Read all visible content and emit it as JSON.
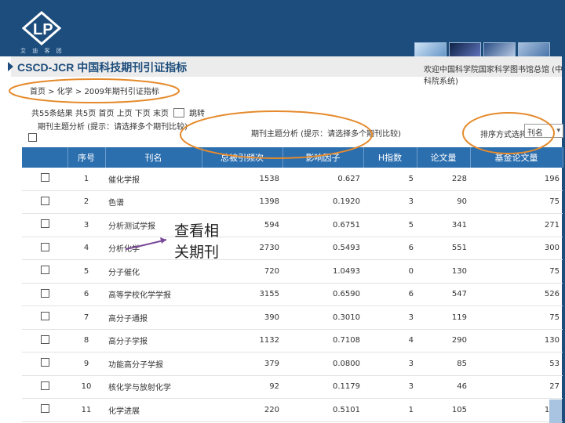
{
  "slide": {
    "logo_text": "艾 迪 客 团",
    "colors": {
      "banner": "#1d4d7c",
      "table_header": "#2c6faf",
      "annotation": "#e58a2c"
    }
  },
  "header": {
    "title": "CSCD-JCR 中国科技期刊引证指标",
    "right_text": "欢迎中国科学院国家科学图书馆总馆 (中科院系统)"
  },
  "breadcrumb": "首页 > 化学 > 2009年期刊引证指标",
  "paging": {
    "text": "共55条结果 共5页 首页 上页 下页 末页",
    "page_value": "",
    "jump_label": "跳转"
  },
  "category_line": "期刊主题分析 (提示：请选择多个期刊比较)",
  "filter_text": "期刊主题分析 (提示：请选择多个期刊比较)",
  "sort": {
    "label": "排序方式选择：",
    "selected": "刊名"
  },
  "table": {
    "headers": [
      "",
      "序号",
      "刊名",
      "总被引频次",
      "影响因子",
      "H指数",
      "论文量",
      "基金论文量"
    ],
    "rows": [
      {
        "n": "1",
        "title": "催化学报",
        "cites": "1538",
        "if": "0.627",
        "h": "5",
        "papers": "228",
        "fund": "196"
      },
      {
        "n": "2",
        "title": "色谱",
        "cites": "1398",
        "if": "0.1920",
        "h": "3",
        "papers": "90",
        "fund": "75"
      },
      {
        "n": "3",
        "title": "分析测试学报",
        "cites": "594",
        "if": "0.6751",
        "h": "5",
        "papers": "341",
        "fund": "271"
      },
      {
        "n": "4",
        "title": "分析化学",
        "cites": "2730",
        "if": "0.5493",
        "h": "6",
        "papers": "551",
        "fund": "300"
      },
      {
        "n": "5",
        "title": "分子催化",
        "cites": "720",
        "if": "1.0493",
        "h": "0",
        "papers": "130",
        "fund": "75"
      },
      {
        "n": "6",
        "title": "高等学校化学学报",
        "cites": "3155",
        "if": "0.6590",
        "h": "6",
        "papers": "547",
        "fund": "526"
      },
      {
        "n": "7",
        "title": "高分子通报",
        "cites": "390",
        "if": "0.3010",
        "h": "3",
        "papers": "119",
        "fund": "75"
      },
      {
        "n": "8",
        "title": "高分子学报",
        "cites": "1132",
        "if": "0.7108",
        "h": "4",
        "papers": "290",
        "fund": "130"
      },
      {
        "n": "9",
        "title": "功能高分子学报",
        "cites": "379",
        "if": "0.0800",
        "h": "3",
        "papers": "85",
        "fund": "53"
      },
      {
        "n": "10",
        "title": "核化学与放射化学",
        "cites": "92",
        "if": "0.1179",
        "h": "3",
        "papers": "46",
        "fund": "27"
      },
      {
        "n": "11",
        "title": "化学进展",
        "cites": "220",
        "if": "0.5101",
        "h": "1",
        "papers": "105",
        "fund": "108"
      }
    ]
  },
  "annotation": {
    "line1": "查看相",
    "line2": "关期刊"
  }
}
